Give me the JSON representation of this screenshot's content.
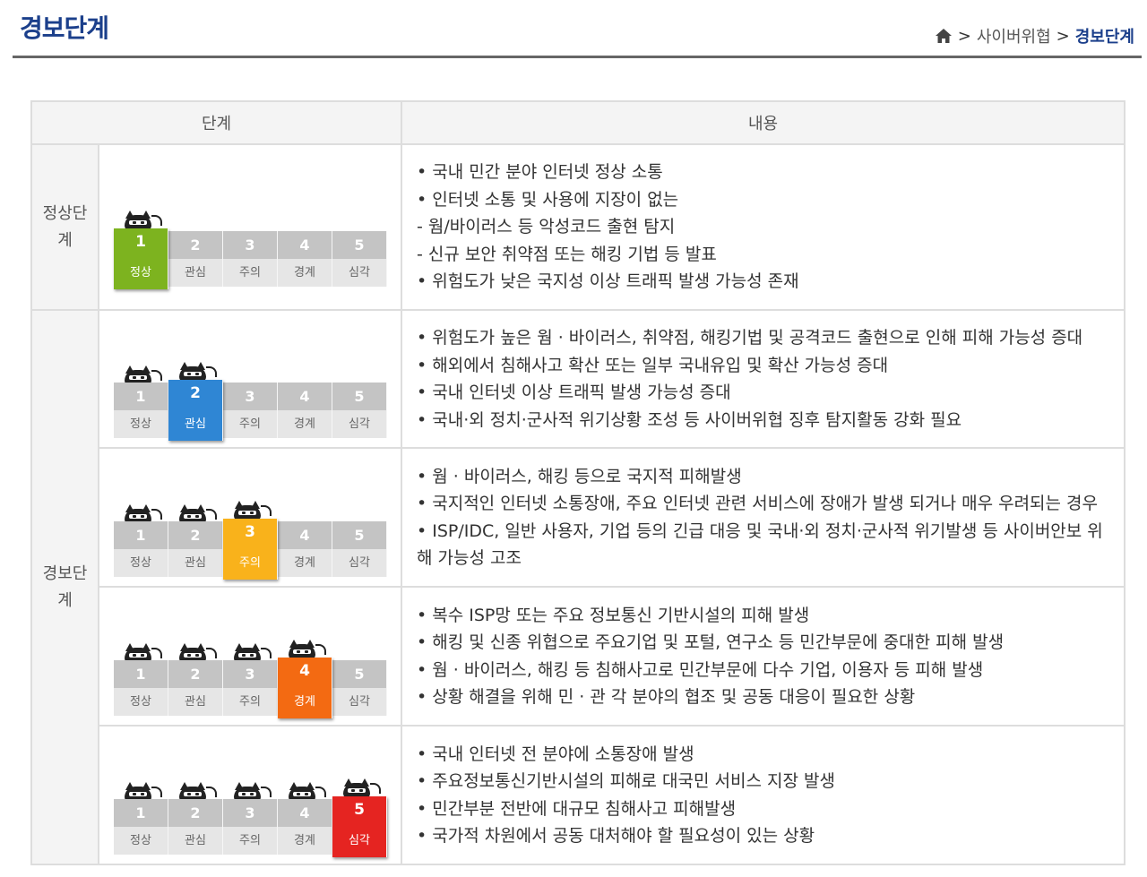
{
  "header": {
    "title": "경보단계",
    "breadcrumb": {
      "sep1": ">",
      "parent": "사이버위협",
      "sep2": ">",
      "current": "경보단계"
    }
  },
  "table": {
    "col_stage": "단계",
    "col_content": "내용",
    "groups": {
      "normal": "정상단계",
      "alert": "경보단계"
    }
  },
  "meter_labels": [
    {
      "num": "1",
      "label": "정상"
    },
    {
      "num": "2",
      "label": "관심"
    },
    {
      "num": "3",
      "label": "주의"
    },
    {
      "num": "4",
      "label": "경계"
    },
    {
      "num": "5",
      "label": "심각"
    }
  ],
  "level_colors": [
    "#7db31f",
    "#2f86d4",
    "#f9b21b",
    "#f36a12",
    "#e52421"
  ],
  "rows": [
    {
      "active_level": 1,
      "lines": [
        "• 국내 민간 분야 인터넷 정상 소통",
        "• 인터넷 소통 및 사용에 지장이 없는",
        "- 웜/바이러스 등 악성코드 출현 탐지",
        "- 신규 보안 취약점 또는 해킹 기법 등 발표",
        "• 위험도가 낮은 국지성 이상 트래픽 발생 가능성 존재"
      ]
    },
    {
      "active_level": 2,
      "lines": [
        "• 위험도가 높은 웜 · 바이러스, 취약점, 해킹기법 및 공격코드 출현으로 인해 피해 가능성 증대",
        "• 해외에서 침해사고 확산 또는 일부 국내유입 및 확산 가능성 증대",
        "• 국내 인터넷 이상 트래픽 발생 가능성 증대",
        "• 국내·외 정치·군사적 위기상황 조성 등 사이버위협 징후 탐지활동 강화 필요"
      ]
    },
    {
      "active_level": 3,
      "lines": [
        "• 웜 · 바이러스, 해킹 등으로 국지적 피해발생",
        "• 국지적인 인터넷 소통장애, 주요 인터넷 관련 서비스에 장애가 발생 되거나 매우 우려되는 경우",
        "• ISP/IDC, 일반 사용자, 기업 등의 긴급 대응 및 국내·외 정치·군사적 위기발생 등 사이버안보 위해 가능성 고조"
      ]
    },
    {
      "active_level": 4,
      "lines": [
        "• 복수 ISP망 또는 주요 정보통신 기반시설의 피해 발생",
        "• 해킹 및 신종 위협으로 주요기업 및 포털, 연구소 등 민간부문에 중대한 피해 발생",
        "• 웜 · 바이러스, 해킹 등 침해사고로 민간부문에 다수 기업, 이용자 등 피해 발생",
        "• 상황 해결을 위해 민 · 관 각 분야의 협조 및 공동 대응이 필요한 상황"
      ]
    },
    {
      "active_level": 5,
      "lines": [
        "• 국내 인터넷 전 분야에 소통장애 발생",
        "• 주요정보통신기반시설의 피해로 대국민 서비스 지장 발생",
        "• 민간부분 전반에 대규모 침해사고 피해발생",
        "• 국가적 차원에서 공동 대처해야 할 필요성이 있는 상황"
      ]
    }
  ]
}
